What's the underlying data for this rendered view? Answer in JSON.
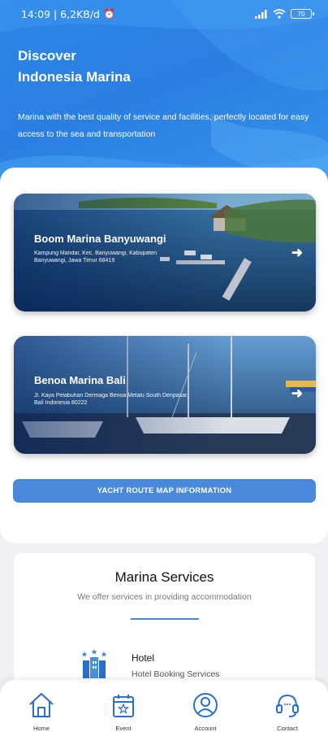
{
  "status_bar": {
    "time_speed": "14:09 | 6,2KB/d",
    "battery": "70"
  },
  "hero": {
    "title_line1": "Discover",
    "title_line2": "Indonesia Marina",
    "description": "Marina with the best quality of service and facilities, perfectly located for easy access to the sea and transportation"
  },
  "marinas": [
    {
      "name": "Boom Marina Banyuwangi",
      "address": "Kampung Mandar, Kec. Banyuwangi, Kabupaten Banyuwangi, Jawa Timur 68419"
    },
    {
      "name": "Benoa Marina Bali",
      "address": "Jl. Kaya Pelabuhan Dermaga Benoa Melalu South Denpasar, Bali Indonesia 80222"
    }
  ],
  "route_button": "YACHT ROUTE MAP INFORMATION",
  "services": {
    "title": "Marina Services",
    "subtitle": "We offer services in providing accommodation",
    "items": [
      {
        "title": "Hotel",
        "subtitle": "Hotel Booking Services",
        "icon": "hotel-icon"
      }
    ]
  },
  "nav": [
    {
      "label": "Home",
      "icon": "home-icon"
    },
    {
      "label": "Event",
      "icon": "calendar-icon"
    },
    {
      "label": "Account",
      "icon": "account-icon"
    },
    {
      "label": "Contact",
      "icon": "headset-icon"
    }
  ],
  "colors": {
    "primary": "#2f86e6",
    "button": "#4a88d9",
    "nav_icon": "#2a6fc9"
  }
}
